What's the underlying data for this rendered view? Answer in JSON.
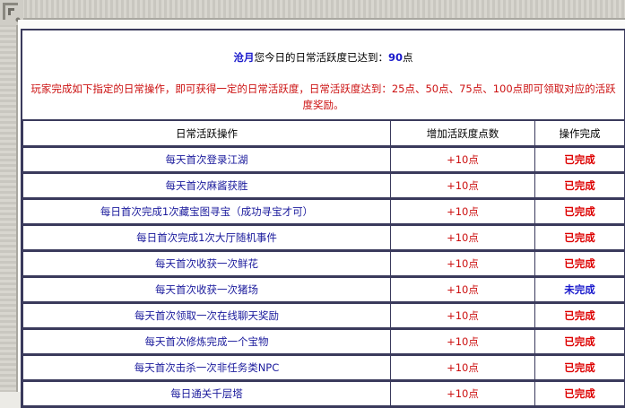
{
  "summary": {
    "player_name": "沧月",
    "score_prefix": "您今日的日常活跃度已达到：",
    "score_value": "90",
    "score_unit": "点",
    "rules": "玩家完成如下指定的日常操作，即可获得一定的日常活跃度，日常活跃度达到：25点、50点、75点、100点即可领取对应的活跃度奖励。"
  },
  "table": {
    "headers": [
      "日常活跃操作",
      "增加活跃度点数",
      "操作完成"
    ],
    "rows": [
      {
        "task": "每天首次登录江湖",
        "points": "+10点",
        "status": "已完成",
        "done": true
      },
      {
        "task": "每天首次麻酱获胜",
        "points": "+10点",
        "status": "已完成",
        "done": true
      },
      {
        "task": "每日首次完成1次藏宝图寻宝（成功寻宝才可）",
        "points": "+10点",
        "status": "已完成",
        "done": true
      },
      {
        "task": "每日首次完成1次大厅随机事件",
        "points": "+10点",
        "status": "已完成",
        "done": true
      },
      {
        "task": "每天首次收获一次鲜花",
        "points": "+10点",
        "status": "已完成",
        "done": true
      },
      {
        "task": "每天首次收获一次猪场",
        "points": "+10点",
        "status": "未完成",
        "done": false
      },
      {
        "task": "每天首次领取一次在线聊天奖励",
        "points": "+10点",
        "status": "已完成",
        "done": true
      },
      {
        "task": "每天首次修炼完成一个宝物",
        "points": "+10点",
        "status": "已完成",
        "done": true
      },
      {
        "task": "每天首次击杀一次非任务类NPC",
        "points": "+10点",
        "status": "已完成",
        "done": true
      },
      {
        "task": "每日通关千层塔",
        "points": "+10点",
        "status": "已完成",
        "done": true
      }
    ]
  }
}
